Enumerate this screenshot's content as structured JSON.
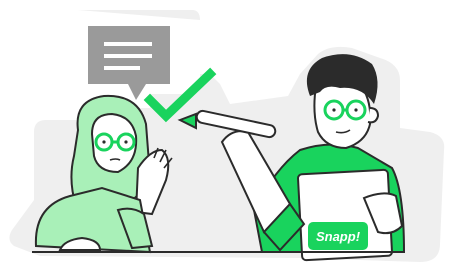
{
  "illustration": {
    "brand_label": "Snapp!",
    "colors": {
      "accent_green": "#19d35d",
      "light_green": "#a9f0b8",
      "ink": "#2b2b2b",
      "bubble_gray": "#9a9a9a",
      "sticker_bg": "#efefef"
    }
  }
}
